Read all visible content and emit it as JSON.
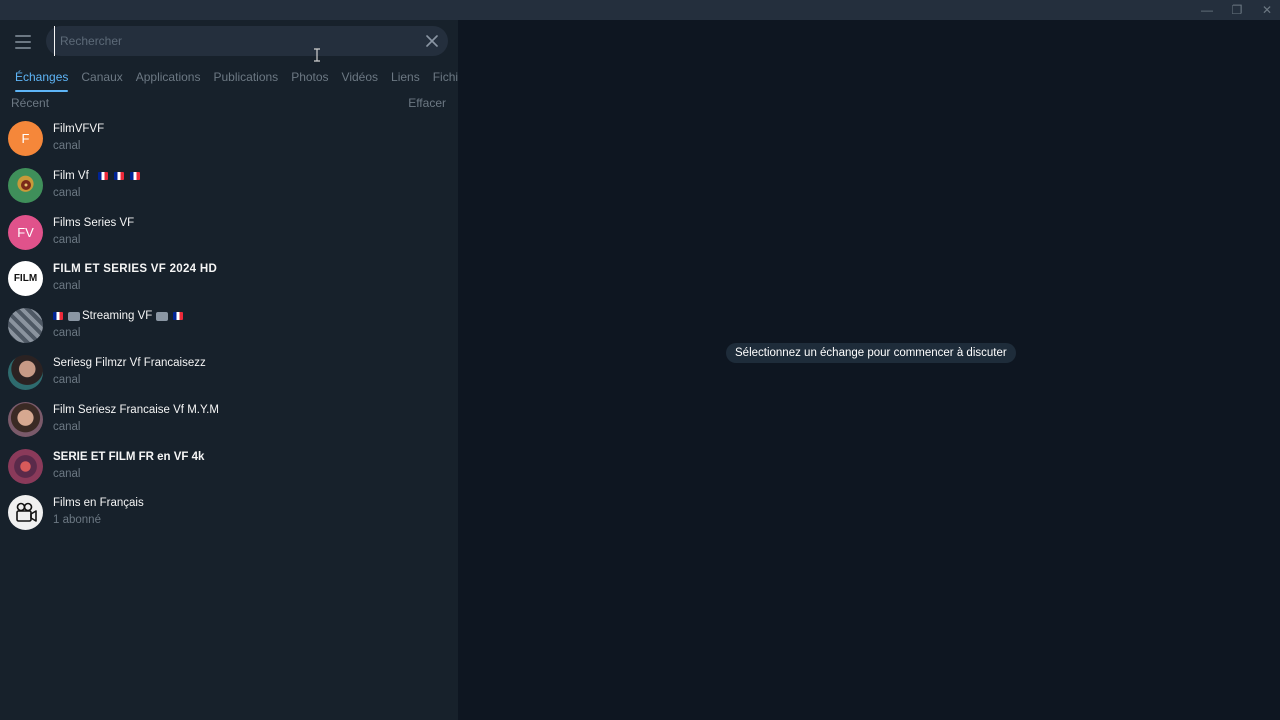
{
  "window": {
    "minimize_glyph": "—",
    "restore_glyph": "❐",
    "close_glyph": "✕"
  },
  "search": {
    "placeholder": "Rechercher",
    "value": ""
  },
  "tabs": [
    {
      "label": "Échanges",
      "active": true
    },
    {
      "label": "Canaux",
      "active": false
    },
    {
      "label": "Applications",
      "active": false
    },
    {
      "label": "Publications",
      "active": false
    },
    {
      "label": "Photos",
      "active": false
    },
    {
      "label": "Vidéos",
      "active": false
    },
    {
      "label": "Liens",
      "active": false
    },
    {
      "label": "Fichiers",
      "active": false
    }
  ],
  "recent": {
    "title": "Récent",
    "clear_label": "Effacer"
  },
  "results": [
    {
      "title": "FilmVFVF",
      "subtitle": "canal",
      "avatar_text": "F",
      "avatar_color": "#f5873a"
    },
    {
      "title": "Film Vf",
      "subtitle": "canal",
      "avatar_text": "",
      "avatar_color": "#3f8f5a"
    },
    {
      "title": "Films Series VF",
      "subtitle": "canal",
      "avatar_text": "FV",
      "avatar_color": "#e0528b"
    },
    {
      "title": "FILM ET SERIES VF 2024 HD",
      "subtitle": "canal",
      "avatar_text": "FILM",
      "avatar_color": "#ffffff"
    },
    {
      "title": "Streaming VF",
      "subtitle": "canal",
      "avatar_text": "",
      "avatar_color": "#6a7480"
    },
    {
      "title": "Seriesg Filmzr Vf Francaisezz",
      "subtitle": "canal",
      "avatar_text": "",
      "avatar_color": "#2e6b6e"
    },
    {
      "title": "Film Seriesz Francaise Vf M.Y.M",
      "subtitle": "canal",
      "avatar_text": "",
      "avatar_color": "#7a5a6a"
    },
    {
      "title": "SERIE ET FILM FR en VF 4k",
      "subtitle": "canal",
      "avatar_text": "",
      "avatar_color": "#8a3a5a"
    },
    {
      "title": "Films en Français",
      "subtitle": "1 abonné",
      "avatar_text": "",
      "avatar_color": "#f0f0f0"
    }
  ],
  "main": {
    "empty_hint": "Sélectionnez un échange pour commencer à discuter"
  },
  "colors": {
    "accent": "#5eb5f7",
    "sidebar_bg": "#17212b",
    "main_bg": "#0e1621",
    "muted_text": "#6c7883"
  }
}
